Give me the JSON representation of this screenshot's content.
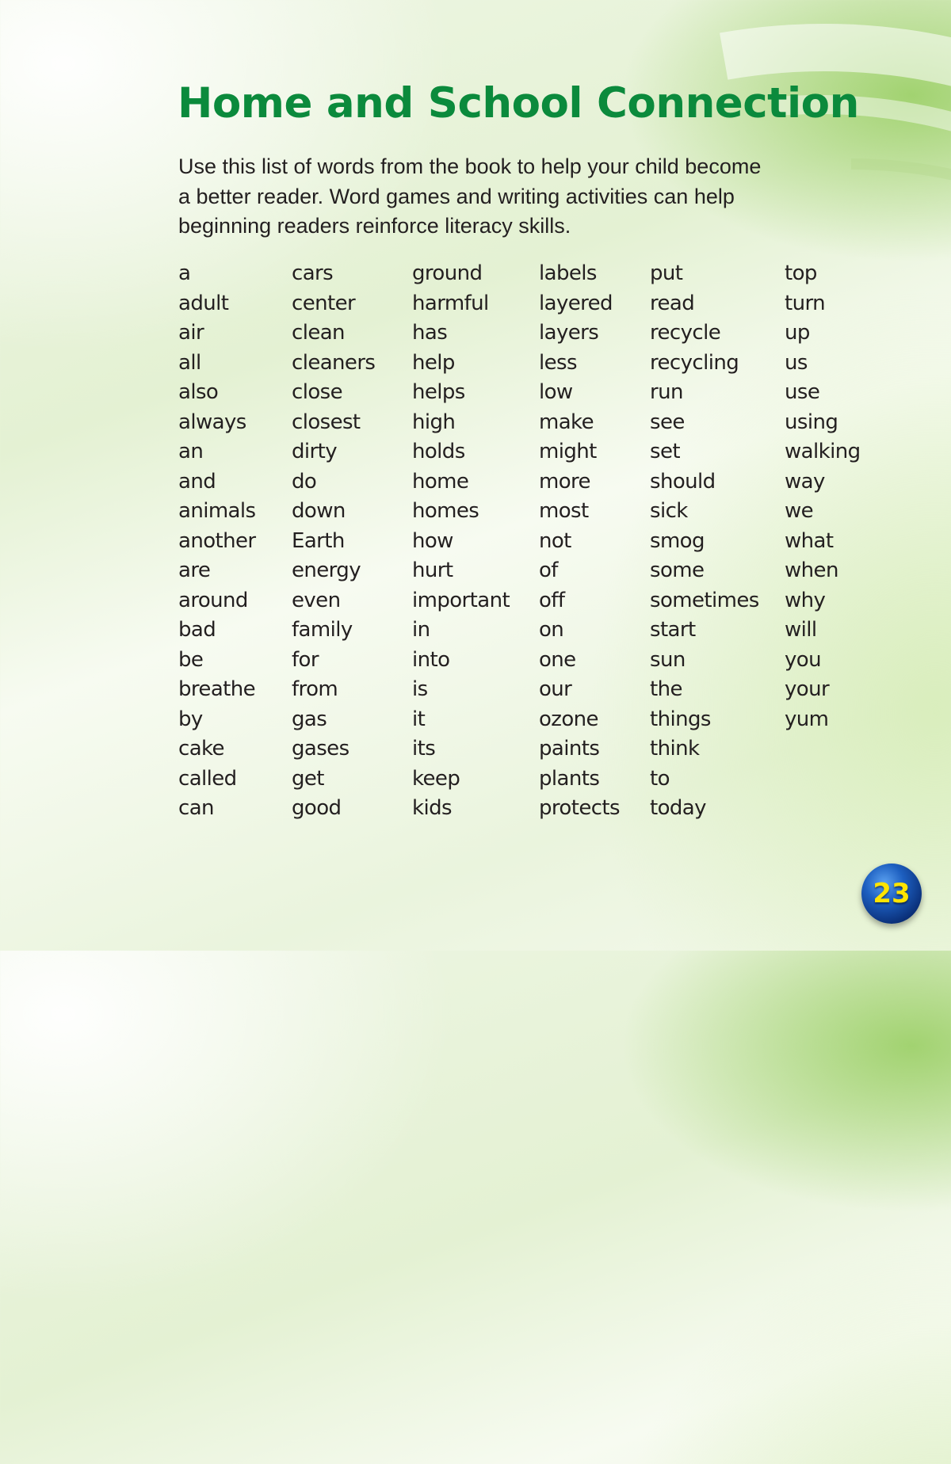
{
  "title": "Home and School Connection",
  "intro": [
    "Use this list of words from the book to help your child become",
    "a better reader. Word games and writing activities can help",
    "beginning readers reinforce literacy skills."
  ],
  "word_columns": [
    [
      "a",
      "adult",
      "air",
      "all",
      "also",
      "always",
      "an",
      "and",
      "animals",
      "another",
      "are",
      "around",
      "bad",
      "be",
      "breathe",
      "by",
      "cake",
      "called",
      "can"
    ],
    [
      "cars",
      "center",
      "clean",
      "cleaners",
      "close",
      "closest",
      "dirty",
      "do",
      "down",
      "Earth",
      "energy",
      "even",
      "family",
      "for",
      "from",
      "gas",
      "gases",
      "get",
      "good"
    ],
    [
      "ground",
      "harmful",
      "has",
      "help",
      "helps",
      "high",
      "holds",
      "home",
      "homes",
      "how",
      "hurt",
      "important",
      "in",
      "into",
      "is",
      "it",
      "its",
      "keep",
      "kids"
    ],
    [
      "labels",
      "layered",
      "layers",
      "less",
      "low",
      "make",
      "might",
      "more",
      "most",
      "not",
      "of",
      "off",
      "on",
      "one",
      "our",
      "ozone",
      "paints",
      "plants",
      "protects"
    ],
    [
      "put",
      "read",
      "recycle",
      "recycling",
      "run",
      "see",
      "set",
      "should",
      "sick",
      "smog",
      "some",
      "sometimes",
      "start",
      "sun",
      "the",
      "things",
      "think",
      "to",
      "today"
    ],
    [
      "top",
      "turn",
      "up",
      "us",
      "use",
      "using",
      "walking",
      "way",
      "we",
      "what",
      "when",
      "why",
      "will",
      "you",
      "your",
      "yum"
    ]
  ],
  "page_number": "23",
  "colors": {
    "title": "#0b8a3c",
    "text": "#231f20",
    "badge_fill": "#0a2f78",
    "badge_text": "#ffe400"
  }
}
